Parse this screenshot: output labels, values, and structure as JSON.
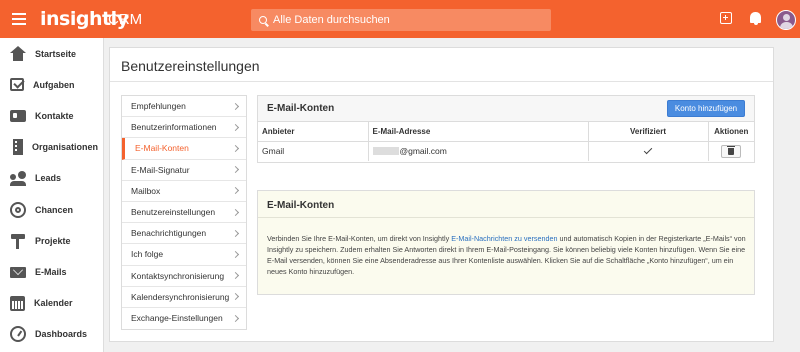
{
  "topbar": {
    "logo": "insightly",
    "product": "CRM",
    "search_placeholder": "Alle Daten durchsuchen"
  },
  "nav": [
    {
      "label": "Startseite",
      "icon": "home-icon"
    },
    {
      "label": "Aufgaben",
      "icon": "task-icon"
    },
    {
      "label": "Kontakte",
      "icon": "contact-icon"
    },
    {
      "label": "Organisationen",
      "icon": "building-icon"
    },
    {
      "label": "Leads",
      "icon": "leads-icon"
    },
    {
      "label": "Chancen",
      "icon": "target-icon"
    },
    {
      "label": "Projekte",
      "icon": "hammer-icon"
    },
    {
      "label": "E-Mails",
      "icon": "mail-icon"
    },
    {
      "label": "Kalender",
      "icon": "calendar-icon"
    },
    {
      "label": "Dashboards",
      "icon": "dashboard-icon"
    }
  ],
  "page": {
    "title": "Benutzereinstellungen"
  },
  "settings_menu": [
    "Empfehlungen",
    "Benutzerinformationen",
    "E-Mail-Konten",
    "E-Mail-Signatur",
    "Mailbox",
    "Benutzereinstellungen",
    "Benachrichtigungen",
    "Ich folge",
    "Kontaktsynchronisierung",
    "Kalendersynchronisierung",
    "Exchange-Einstellungen"
  ],
  "settings_menu_active": "E-Mail-Konten",
  "accounts": {
    "title": "E-Mail-Konten",
    "add_button": "Konto hinzufügen",
    "columns": [
      "Anbieter",
      "E-Mail-Adresse",
      "Verifiziert",
      "Aktionen"
    ],
    "rows": [
      {
        "provider": "Gmail",
        "email_suffix": "@gmail.com",
        "verified": true
      }
    ]
  },
  "info": {
    "title": "E-Mail-Konten",
    "text_before": "Verbinden Sie Ihre E-Mail-Konten, um direkt von Insightly ",
    "link": "E-Mail-Nachrichten zu versenden",
    "text_after": " und automatisch Kopien in der Registerkarte „E-Mails“ von Insightly zu speichern. Zudem erhalten Sie Antworten direkt in Ihrem E-Mail-Posteingang. Sie können beliebig viele Konten hinzufügen. Wenn Sie eine E-Mail versenden, können Sie eine Absenderadresse aus Ihrer Kontenliste auswählen. Klicken Sie auf die Schaltfläche „Konto hinzufügen“, um ein neues Konto hinzuzufügen."
  },
  "colors": {
    "brand": "#f4622e",
    "button": "#4a8ce0",
    "link": "#2a6fbf"
  }
}
